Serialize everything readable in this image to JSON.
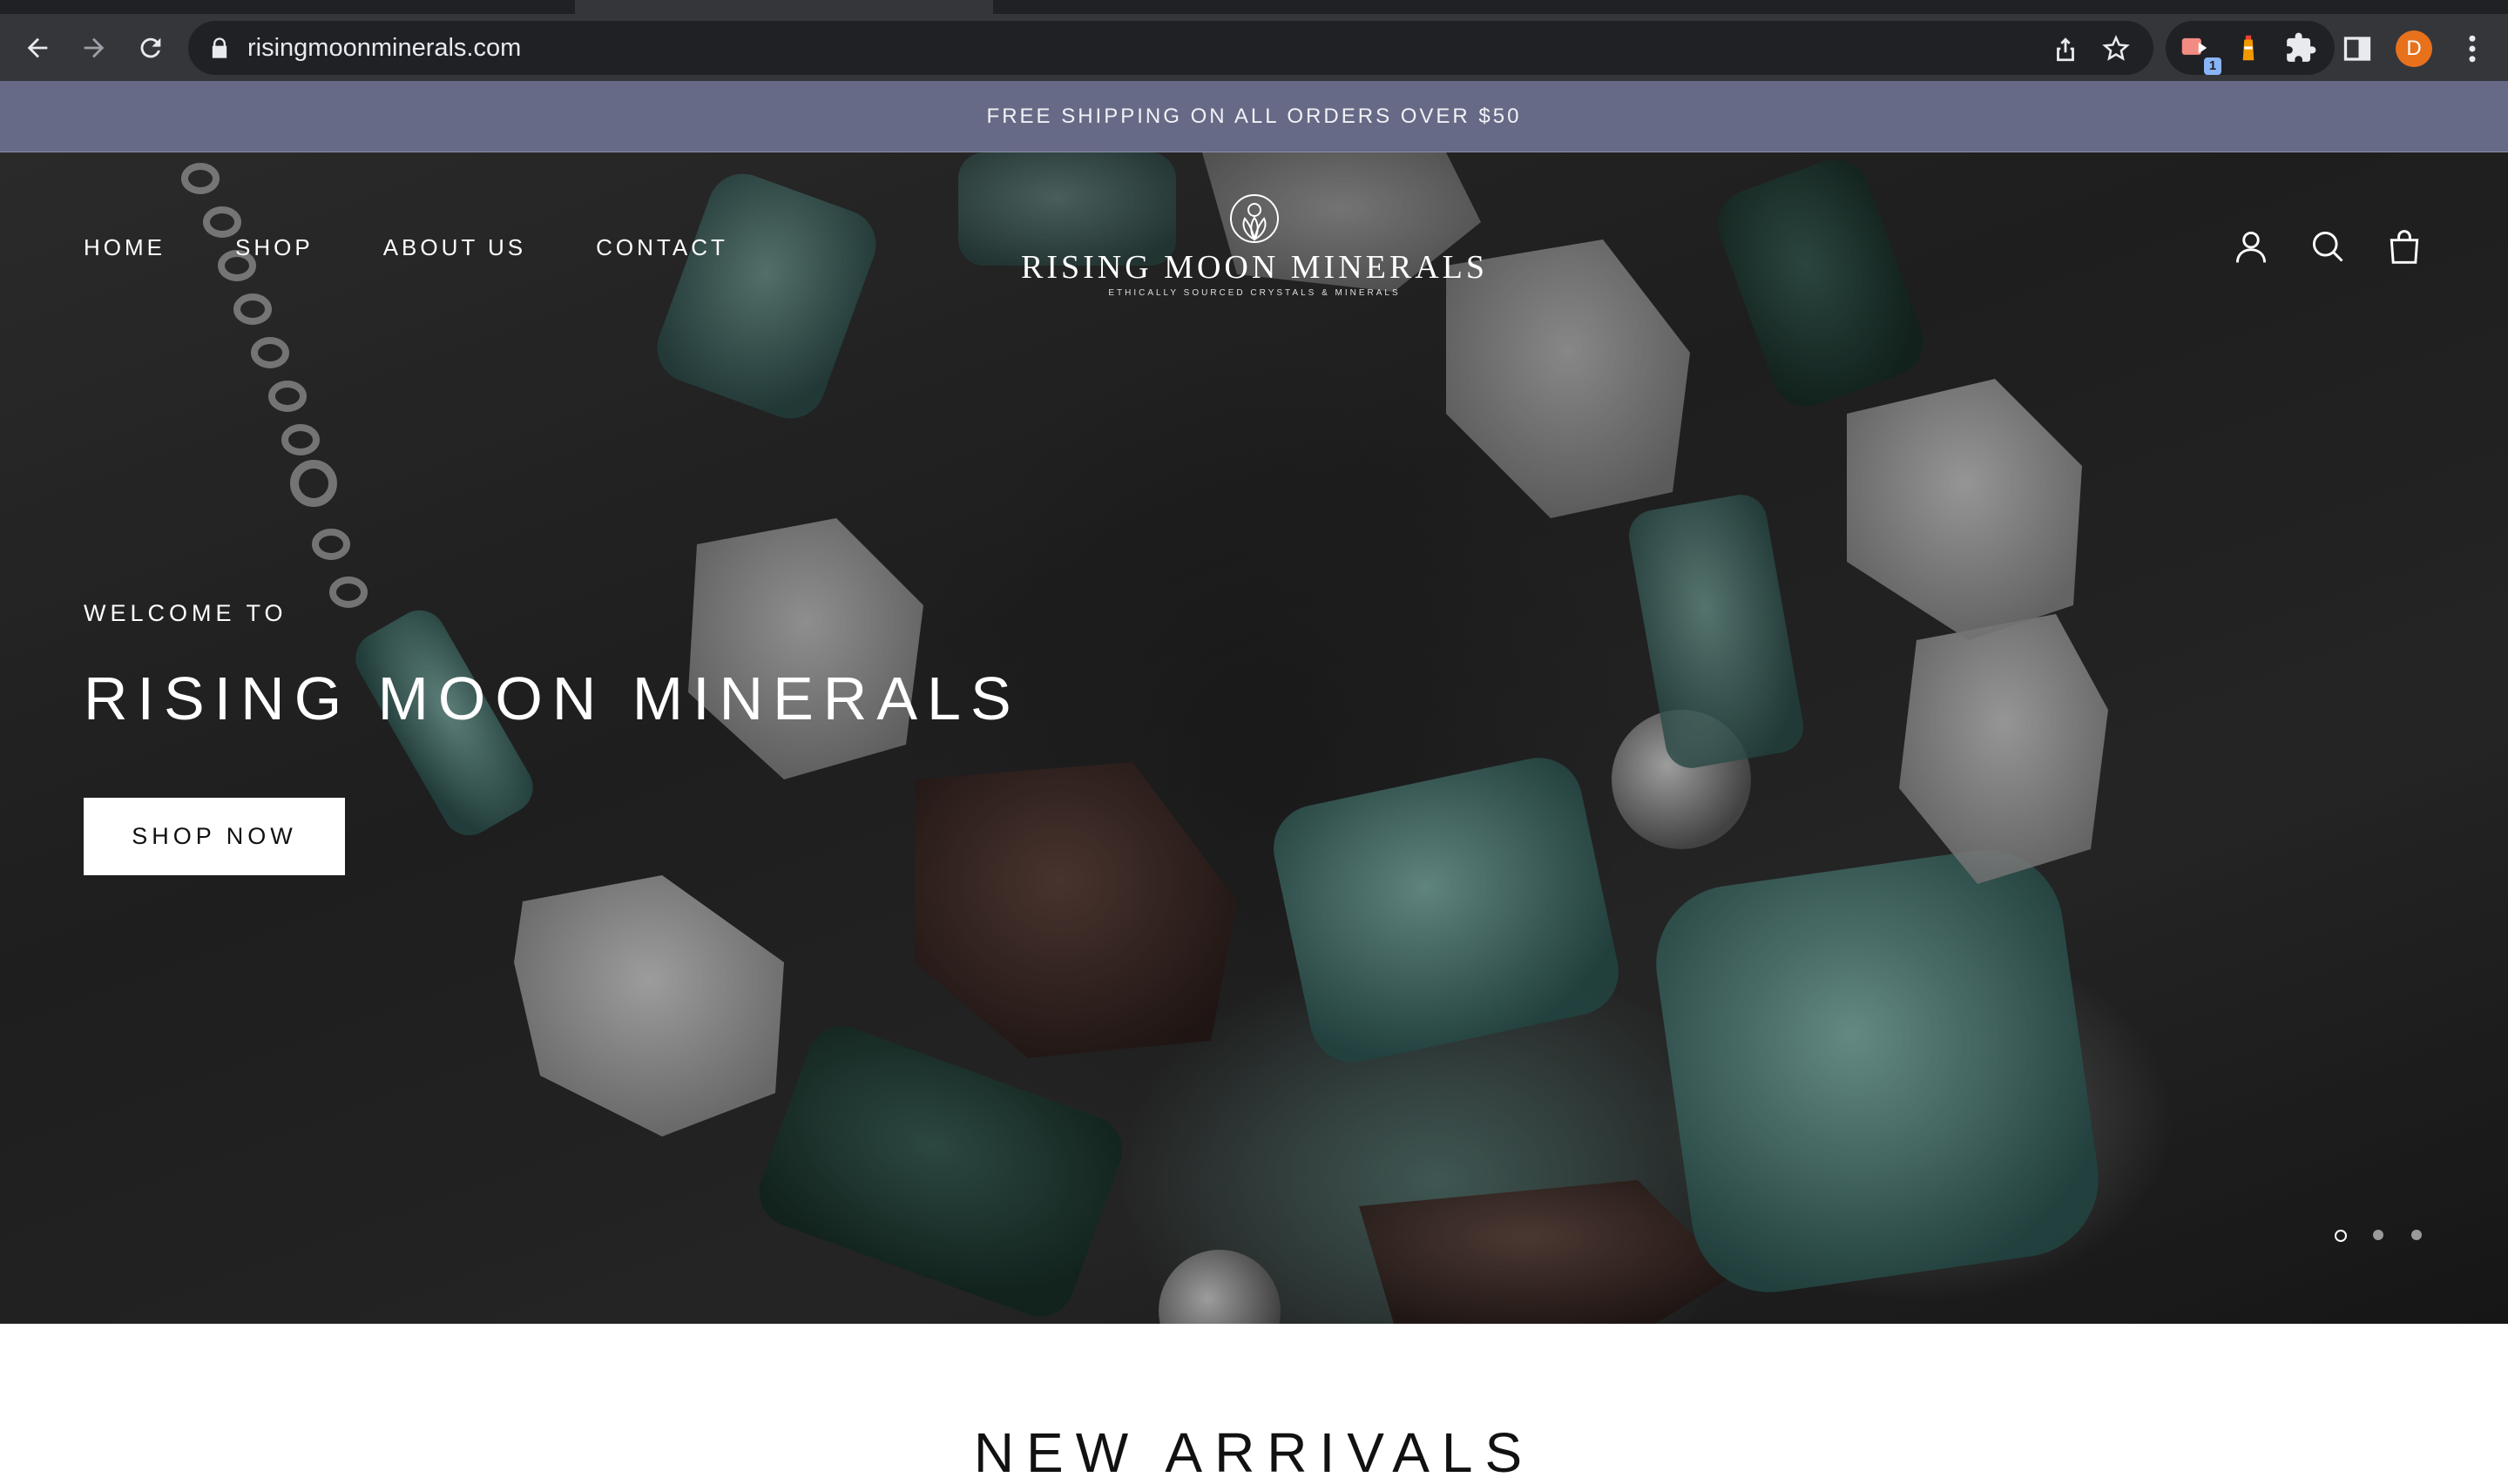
{
  "browser": {
    "url": "risingmoonminerals.com",
    "extension_badge": "1",
    "profile_initial": "D",
    "colors": {
      "toolbar": "#35363a",
      "omnibox": "#202124",
      "avatar": "#e8711c"
    },
    "icons": [
      "back-icon",
      "forward-icon",
      "reload-icon",
      "lock-icon",
      "share-icon",
      "bookmark-star-icon",
      "extension-icon",
      "puzzle-icon",
      "side-panel-icon",
      "kebab-menu-icon"
    ]
  },
  "announcement": {
    "text": "FREE SHIPPING ON ALL ORDERS OVER $50",
    "color": "#666a86"
  },
  "header": {
    "nav": [
      "HOME",
      "SHOP",
      "ABOUT US",
      "CONTACT"
    ],
    "logo_name": "RISING MOON MINERALS",
    "logo_tagline": "ETHICALLY SOURCED CRYSTALS & MINERALS",
    "icons": [
      "account-icon",
      "search-icon",
      "cart-bag-icon"
    ]
  },
  "hero": {
    "kicker": "WELCOME TO",
    "title": "RISING MOON MINERALS",
    "cta": "SHOP NOW",
    "slides": {
      "count": 3,
      "active": 1
    }
  },
  "next_section": {
    "title": "NEW ARRIVALS"
  }
}
